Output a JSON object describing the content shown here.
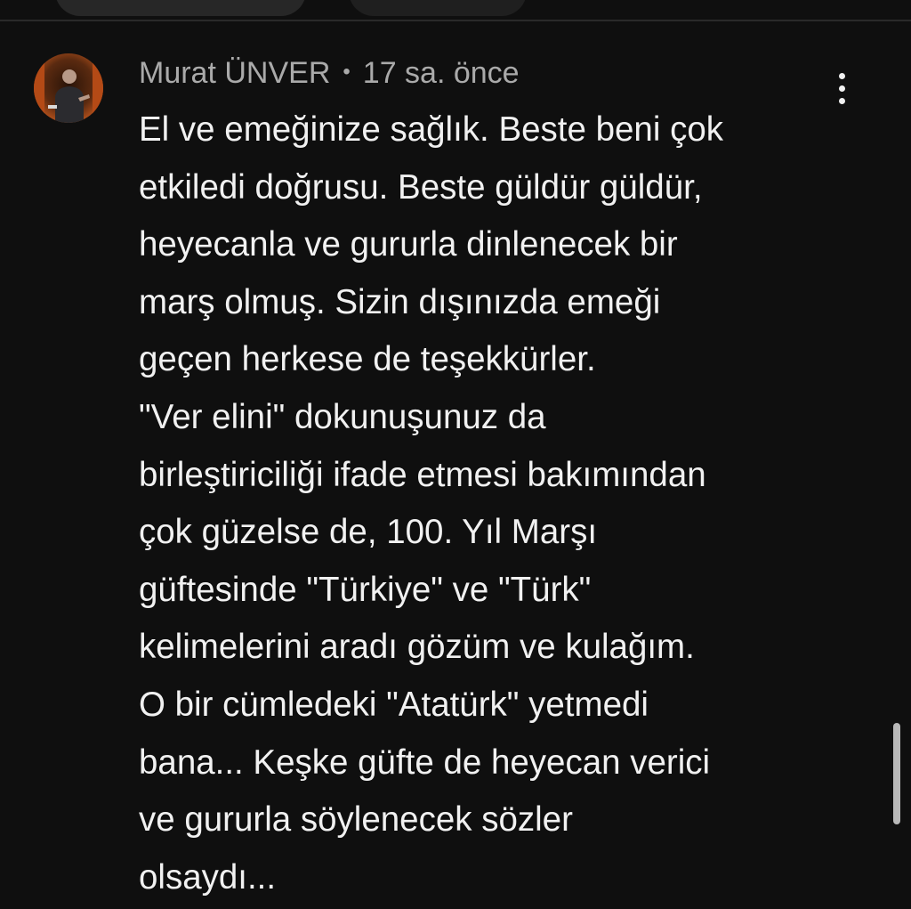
{
  "comment": {
    "author": "Murat ÜNVER",
    "separator": "•",
    "timestamp": "17 sa. önce",
    "lines": [
      "El ve emeğinize sağlık. Beste beni çok",
      "etkiledi doğrusu. Beste güldür güldür,",
      "heyecanla ve gururla dinlenecek bir",
      "marş olmuş. Sizin dışınızda emeği",
      "geçen herkese de teşekkürler.",
      "\"Ver elini\" dokunuşunuz da",
      "birleştiriciliği ifade etmesi bakımından",
      "çok güzelse de, 100. Yıl Marşı",
      "güftesinde \"Türkiye\" ve \"Türk\"",
      "kelimelerini aradı gözüm ve kulağım.",
      "O bir cümledeki \"Atatürk\" yetmedi",
      "bana... Keşke güfte de heyecan verici",
      "ve gururla söylenecek sözler",
      "olsaydı..."
    ]
  },
  "icons": {
    "more": "more-vertical-icon",
    "avatar": "user-avatar"
  },
  "colors": {
    "background": "#0f0f0f",
    "primary_text": "#f1f1f1",
    "secondary_text": "#aaaaaa",
    "scrollbar": "#b8b8b8"
  }
}
